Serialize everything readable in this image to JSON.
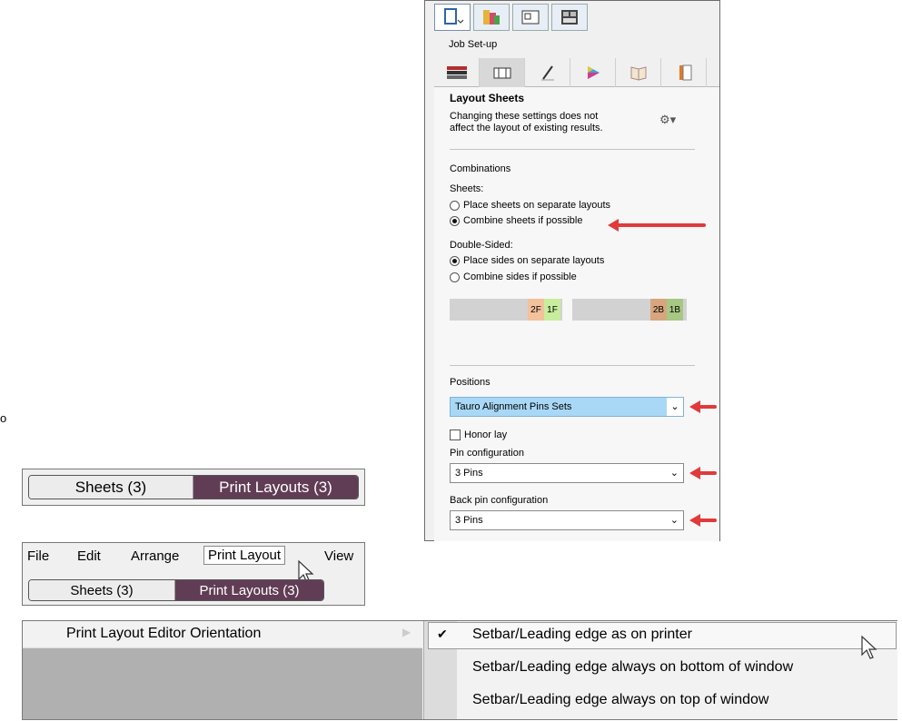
{
  "panel": {
    "job_setup": "Job Set-up",
    "title": "Layout Sheets",
    "desc_line1": "Changing these settings does not",
    "desc_line2": "affect the layout of existing results.",
    "combinations": "Combinations",
    "sheets_label": "Sheets:",
    "sheets_options": [
      "Place sheets on separate layouts",
      "Combine sheets if possible"
    ],
    "double_sided_label": "Double-Sided:",
    "double_options": [
      "Place sides on separate layouts",
      "Combine sides if possible"
    ],
    "chips": [
      "2F",
      "1F",
      "2B",
      "1B"
    ],
    "positions": "Positions",
    "positions_value": "Tauro Alignment Pins Sets",
    "honor_lay": "Honor lay",
    "pin_config_label": "Pin configuration",
    "pin_config_value": "3 Pins",
    "back_pin_label": "Back pin configuration",
    "back_pin_value": "3 Pins",
    "colors": {
      "arrow": "#e03a3a",
      "selected_dropdown": "#a9d8f7",
      "chip_orange": "#f3c19b",
      "chip_green": "#c8ed9c",
      "chip_tan": "#d7a67f",
      "chip_olive": "#a6c883"
    }
  },
  "left": {
    "stray": "o",
    "tabs1": {
      "sheets": "Sheets (3)",
      "layouts": "Print Layouts (3)"
    },
    "menu": {
      "items": [
        "File",
        "Edit",
        "Arrange",
        "Print Layout",
        "View"
      ]
    },
    "tabs2": {
      "sheets": "Sheets (3)",
      "layouts": "Print Layouts (3)"
    },
    "pill_color": "#613d55"
  },
  "orientation": {
    "menu_item": "Print Layout Editor Orientation",
    "options": [
      "Setbar/Leading edge as on printer",
      "Setbar/Leading edge always on bottom of window",
      "Setbar/Leading edge always on top of window"
    ],
    "check": "✔"
  }
}
